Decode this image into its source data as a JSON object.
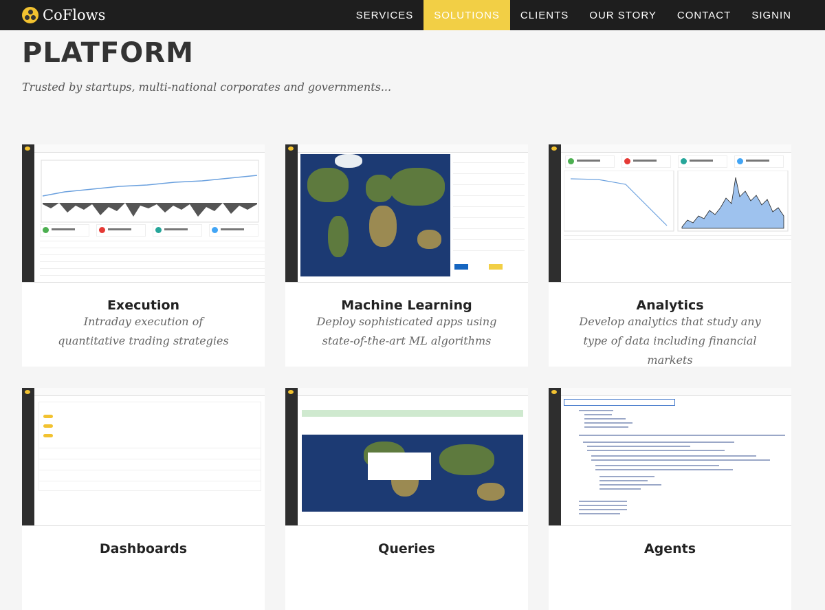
{
  "brand": {
    "name": "CoFlows"
  },
  "nav": {
    "items": [
      {
        "label": "SERVICES"
      },
      {
        "label": "SOLUTIONS"
      },
      {
        "label": "CLIENTS"
      },
      {
        "label": "OUR STORY"
      },
      {
        "label": "CONTACT"
      },
      {
        "label": "SIGNIN"
      }
    ],
    "active": "SOLUTIONS"
  },
  "page": {
    "title": "PLATFORM",
    "tagline": "Trusted by startups, multi-national corporates and governments..."
  },
  "cards": [
    {
      "title": "Execution",
      "description": "Intraday execution of quantitative trading strategies"
    },
    {
      "title": "Machine Learning",
      "description": "Deploy sophisticated apps using state-of-the-art ML algorithms"
    },
    {
      "title": "Analytics",
      "description": "Develop analytics that study any type of data including financial markets"
    },
    {
      "title": "Dashboards",
      "description": ""
    },
    {
      "title": "Queries",
      "description": ""
    },
    {
      "title": "Agents",
      "description": ""
    }
  ],
  "colors": {
    "topbar": "#1e1e1e",
    "accent": "#f2cf45",
    "background": "#f5f5f5"
  }
}
